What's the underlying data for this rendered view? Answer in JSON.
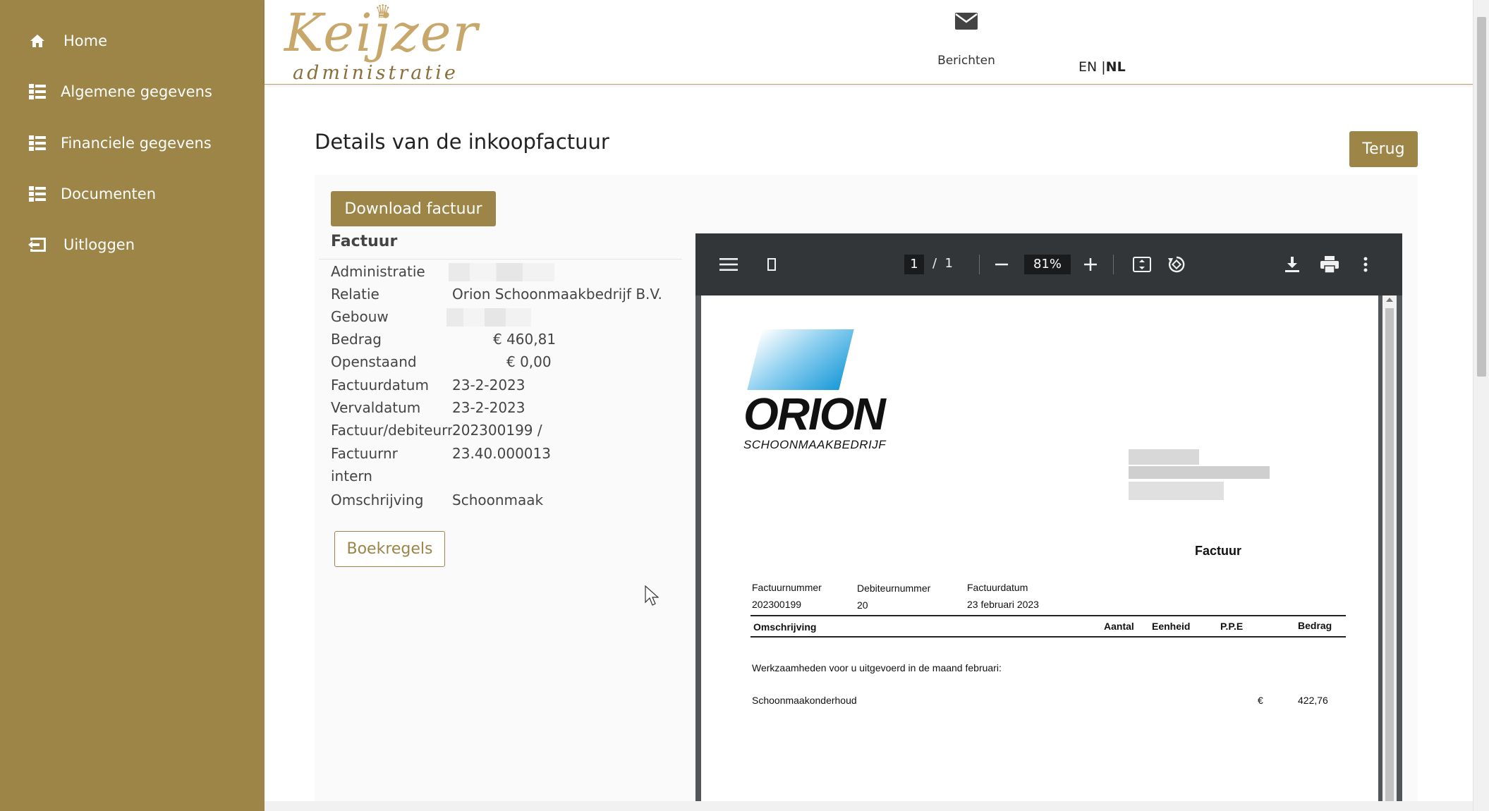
{
  "sidebar": {
    "items": [
      {
        "label": "Home",
        "icon": "home-icon"
      },
      {
        "label": "Algemene gegevens",
        "icon": "list-icon"
      },
      {
        "label": "Financiele gegevens",
        "icon": "list-icon"
      },
      {
        "label": "Documenten",
        "icon": "list-icon"
      },
      {
        "label": "Uitloggen",
        "icon": "logout-icon"
      }
    ]
  },
  "header": {
    "logo_main": "Keijzer",
    "logo_sub": "administratie",
    "messages_label": "Berichten",
    "lang_en": "EN",
    "lang_sep": " |",
    "lang_nl": "NL"
  },
  "page": {
    "title": "Details van de inkoopfactuur",
    "back_label": "Terug",
    "download_label": "Download factuur",
    "section_title": "Factuur",
    "booklines_label": "Boekregels"
  },
  "fields": [
    {
      "label": "Administratie",
      "value": ""
    },
    {
      "label": "Relatie",
      "value": "Orion Schoonmaakbedrijf B.V."
    },
    {
      "label": "Gebouw",
      "value": ""
    },
    {
      "label": "Bedrag",
      "value": "€ 460,81"
    },
    {
      "label": "Openstaand",
      "value": "€ 0,00"
    },
    {
      "label": "Factuurdatum",
      "value": "23-2-2023"
    },
    {
      "label": "Vervaldatum",
      "value": "23-2-2023"
    },
    {
      "label": "Factuur/debiteurnr",
      "value": "202300199 /"
    },
    {
      "label": "Factuurnr",
      "value": "23.40.000013"
    },
    {
      "label": "intern",
      "value": ""
    },
    {
      "label": "Omschrijving",
      "value": "Schoonmaak"
    }
  ],
  "pdf_viewer": {
    "current_page": "1",
    "page_separator": "/",
    "total_pages": "1",
    "zoom": "81%",
    "document": {
      "logo_name": "ORION",
      "logo_sub": "SCHOONMAAKBEDRIJF",
      "title": "Factuur",
      "col1_label": "Factuurnummer",
      "col1_value": "202300199",
      "col2_label": "Debiteurnummer",
      "col2_value": "20",
      "col3_label": "Factuurdatum",
      "col3_value": "23 februari 2023",
      "th_description": "Omschrijving",
      "th_qty": "Aantal",
      "th_unit": "Eenheid",
      "th_ppe": "P.P.E",
      "th_amount": "Bedrag",
      "intro_line": "Werkzaamheden voor u uitgevoerd in de maand februari:",
      "line_item": "Schoonmaakonderhoud",
      "line_currency": "€",
      "line_amount": "422,76"
    }
  },
  "colors": {
    "brand": "#9c8547",
    "pdf_toolbar": "#323639",
    "orion_blue": "#1a9ad8"
  }
}
